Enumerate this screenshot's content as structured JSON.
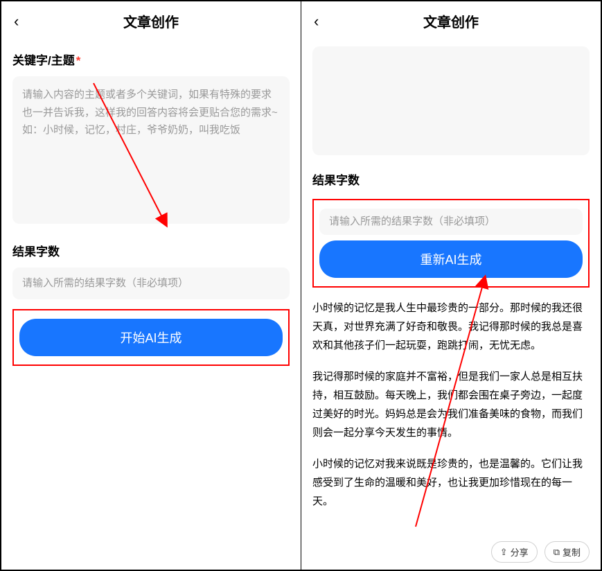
{
  "left": {
    "header_title": "文章创作",
    "keyword_label": "关键字/主题",
    "required_mark": "*",
    "keyword_placeholder": "请输入内容的主题或者多个关键词，如果有特殊的要求也一并告诉我，这样我的回答内容将会更贴合您的需求~\n如：小时候，记忆，村庄，爷爷奶奶，叫我吃饭",
    "result_count_label": "结果字数",
    "result_count_placeholder": "请输入所需的结果字数（非必填项）",
    "button_label": "开始AI生成"
  },
  "right": {
    "header_title": "文章创作",
    "result_count_label": "结果字数",
    "result_count_placeholder": "请输入所需的结果字数（非必填项）",
    "button_label": "重新AI生成",
    "result_p1": "小时候的记忆是我人生中最珍贵的一部分。那时候的我还很天真，对世界充满了好奇和敬畏。我记得那时候的我总是喜欢和其他孩子们一起玩耍，跑跳打闹，无忧无虑。",
    "result_p2": "我记得那时候的家庭并不富裕，但是我们一家人总是相互扶持，相互鼓励。每天晚上，我们都会围在桌子旁边，一起度过美好的时光。妈妈总是会为我们准备美味的食物，而我们则会一起分享今天发生的事情。",
    "result_p3": "小时候的记忆对我来说既是珍贵的，也是温馨的。它们让我感受到了生命的温暖和美好，也让我更加珍惜现在的每一天。",
    "share_label": "分享",
    "copy_label": "复制"
  }
}
